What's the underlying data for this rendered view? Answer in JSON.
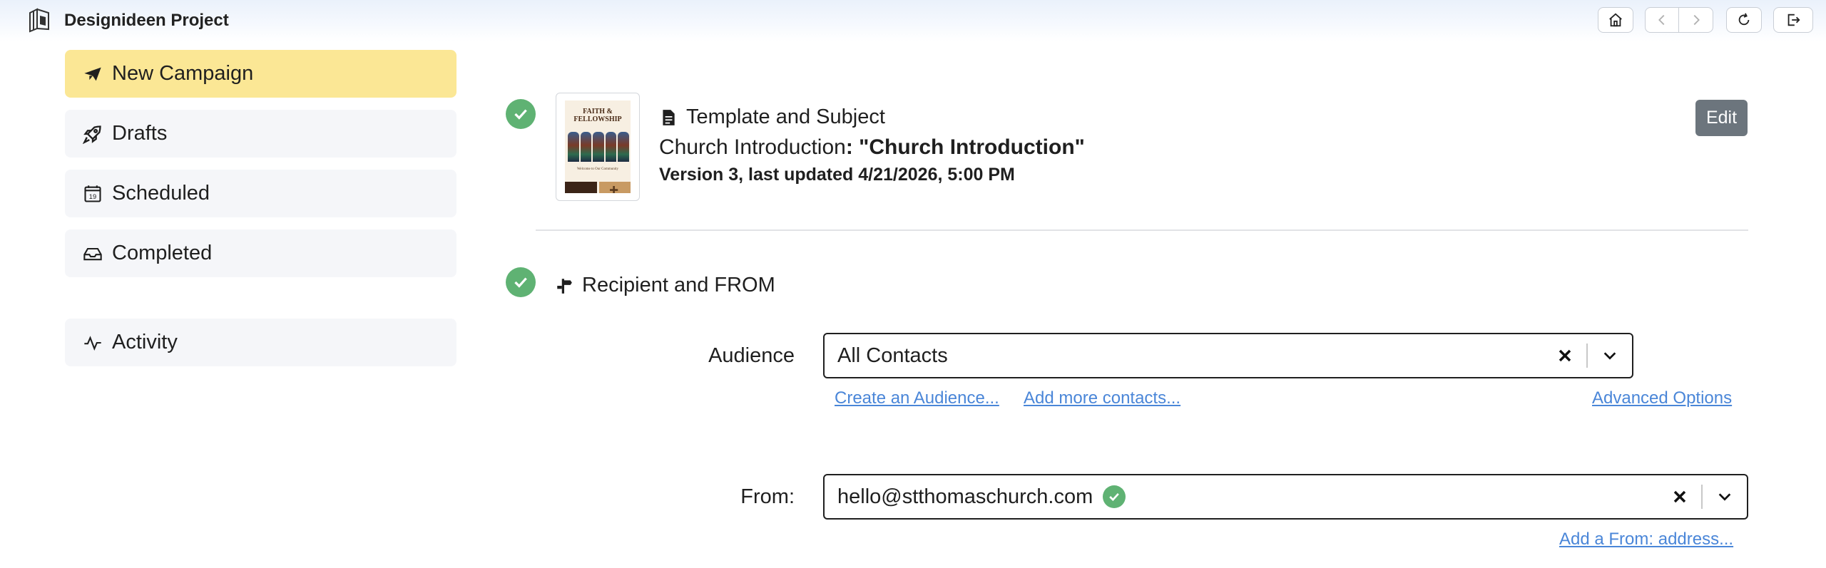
{
  "app": {
    "title": "Designideen Project"
  },
  "toolbar": {
    "home": "home-icon",
    "back": "chevron-left-icon",
    "forward": "chevron-right-icon",
    "refresh": "refresh-icon",
    "logout": "logout-icon"
  },
  "sidebar": {
    "items": [
      {
        "label": "New Campaign",
        "icon": "paper-plane-icon",
        "active": true
      },
      {
        "label": "Drafts",
        "icon": "rocket-icon",
        "active": false
      },
      {
        "label": "Scheduled",
        "icon": "calendar-icon",
        "calendar_day": "19",
        "active": false
      },
      {
        "label": "Completed",
        "icon": "inbox-icon",
        "active": false
      },
      {
        "label": "Activity",
        "icon": "activity-icon",
        "active": false
      }
    ]
  },
  "template_section": {
    "title": "Template and Subject",
    "template_name": "Church Introduction",
    "subject_separator": ": ",
    "subject": "\"Church Introduction\"",
    "version_line": "Version 3, last updated 4/21/2026, 5:00 PM",
    "edit_label": "Edit",
    "thumbnail": {
      "heading": "FAITH & FELLOWSHIP",
      "subheading": "Welcome to Our Community"
    }
  },
  "recipient_section": {
    "title": "Recipient and FROM",
    "audience": {
      "label": "Audience",
      "value": "All Contacts",
      "links": {
        "create": "Create an Audience...",
        "add": "Add more contacts...",
        "advanced": "Advanced Options"
      }
    },
    "from": {
      "label": "From:",
      "value": "hello@stthomaschurch.com",
      "verified": true,
      "link": "Add a From: address..."
    }
  },
  "colors": {
    "active_nav": "#fbe795",
    "nav_bg": "#f5f6f9",
    "success": "#5fb273",
    "edit_button": "#6c757d",
    "link": "#4a86d8"
  }
}
